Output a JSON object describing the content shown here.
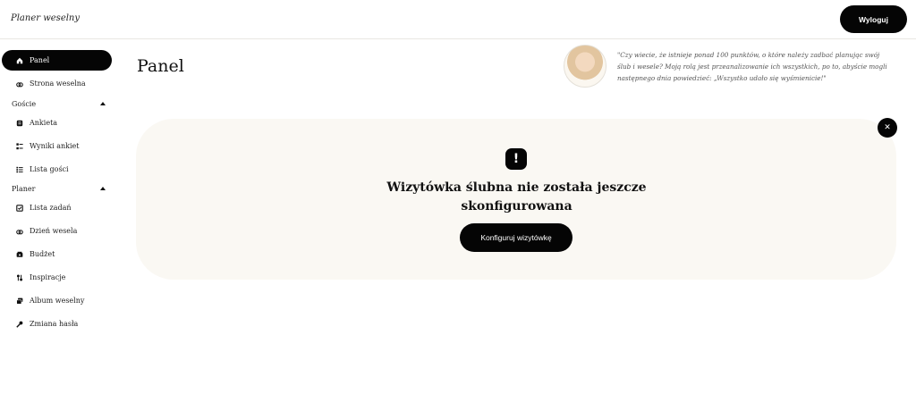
{
  "app": {
    "brand": "Planer weselny"
  },
  "header": {
    "logout_label": "Wyloguj"
  },
  "sidebar": {
    "items": [
      {
        "label": "Panel",
        "icon": "home-icon",
        "active": true
      },
      {
        "label": "Strona weselna",
        "icon": "rings-icon"
      }
    ],
    "groups": [
      {
        "label": "Goście",
        "items": [
          {
            "label": "Ankieta",
            "icon": "clipboard-icon"
          },
          {
            "label": "Wyniki ankiet",
            "icon": "checklist-icon"
          },
          {
            "label": "Lista gości",
            "icon": "list-icon"
          }
        ]
      },
      {
        "label": "Planer",
        "items": [
          {
            "label": "Lista zadań",
            "icon": "tasks-icon"
          },
          {
            "label": "Dzień wesela",
            "icon": "rings-icon"
          },
          {
            "label": "Budżet",
            "icon": "budget-icon"
          },
          {
            "label": "Inspiracje",
            "icon": "inspiration-icon"
          },
          {
            "label": "Album weselny",
            "icon": "album-icon"
          },
          {
            "label": "Zmiana hasła",
            "icon": "key-icon"
          }
        ]
      }
    ]
  },
  "main": {
    "title": "Panel",
    "quote": "\"Czy wiecie, że istnieje ponad 100 punktów, o które należy zadbać planując swój ślub i wesele? Moją rolą jest przeanalizowanie ich wszystkich, po to, abyście mogli następnego dnia powiedzieć: „Wszystko udało się wyśmienicie!\"",
    "card": {
      "heading": "Wizytówka ślubna nie została jeszcze skonfigurowana",
      "button_label": "Konfiguruj wizytówkę",
      "alert_icon": "exclamation-icon",
      "close_icon": "close-icon"
    }
  },
  "colors": {
    "accent": "#050505",
    "card_bg": "#faf8f3",
    "border": "#e9e7e2"
  }
}
